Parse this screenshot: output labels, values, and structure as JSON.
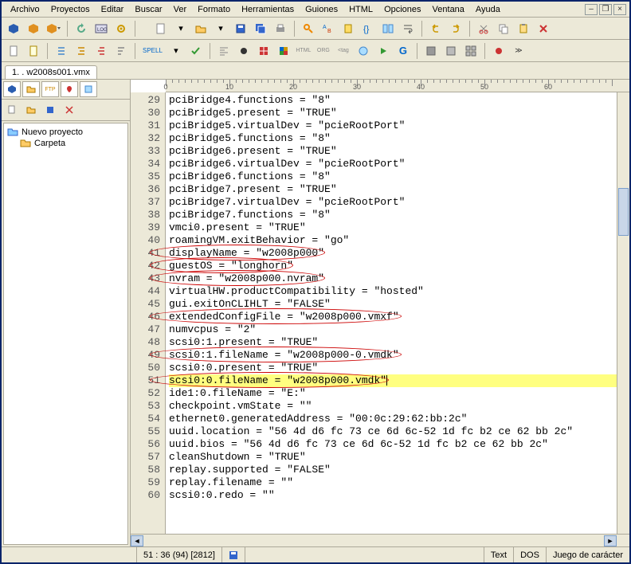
{
  "menu": [
    "Archivo",
    "Proyectos",
    "Editar",
    "Buscar",
    "Ver",
    "Formato",
    "Herramientas",
    "Guiones",
    "HTML",
    "Opciones",
    "Ventana",
    "Ayuda"
  ],
  "tab": "1. . w2008s001.vmx",
  "tree": {
    "root": "Nuevo proyecto",
    "child": "Carpeta"
  },
  "ruler_labels": [
    0,
    10,
    20,
    30,
    40,
    50,
    60
  ],
  "lines": [
    {
      "n": 29,
      "t": "pciBridge4.functions = \"8\""
    },
    {
      "n": 30,
      "t": "pciBridge5.present = \"TRUE\""
    },
    {
      "n": 31,
      "t": "pciBridge5.virtualDev = \"pcieRootPort\""
    },
    {
      "n": 32,
      "t": "pciBridge5.functions = \"8\""
    },
    {
      "n": 33,
      "t": "pciBridge6.present = \"TRUE\""
    },
    {
      "n": 34,
      "t": "pciBridge6.virtualDev = \"pcieRootPort\""
    },
    {
      "n": 35,
      "t": "pciBridge6.functions = \"8\""
    },
    {
      "n": 36,
      "t": "pciBridge7.present = \"TRUE\""
    },
    {
      "n": 37,
      "t": "pciBridge7.virtualDev = \"pcieRootPort\""
    },
    {
      "n": 38,
      "t": "pciBridge7.functions = \"8\""
    },
    {
      "n": 39,
      "t": "vmci0.present = \"TRUE\""
    },
    {
      "n": 40,
      "t": "roamingVM.exitBehavior = \"go\""
    },
    {
      "n": 41,
      "t": "displayName = \"w2008p000\"",
      "circle": true
    },
    {
      "n": 42,
      "t": "guestOS = \"longhorn\"",
      "circle": true
    },
    {
      "n": 43,
      "t": "nvram = \"w2008p000.nvram\"",
      "circle": true
    },
    {
      "n": 44,
      "t": "virtualHW.productCompatibility = \"hosted\""
    },
    {
      "n": 45,
      "t": "gui.exitOnCLIHLT = \"FALSE\""
    },
    {
      "n": 46,
      "t": "extendedConfigFile = \"w2008p000.vmxf\"",
      "circle": true
    },
    {
      "n": 47,
      "t": "numvcpus = \"2\""
    },
    {
      "n": 48,
      "t": "scsi0:1.present = \"TRUE\""
    },
    {
      "n": 49,
      "t": "scsi0:1.fileName = \"w2008p000-0.vmdk\"",
      "circle": true
    },
    {
      "n": 50,
      "t": "scsi0:0.present = \"TRUE\""
    },
    {
      "n": 51,
      "t": "scsi0:0.fileName = \"w2008p000.vmdk\"",
      "hl": true,
      "circle": true,
      "cursor": true
    },
    {
      "n": 52,
      "t": "ide1:0.fileName = \"E:\""
    },
    {
      "n": 53,
      "t": "checkpoint.vmState = \"\""
    },
    {
      "n": 54,
      "t": "ethernet0.generatedAddress = \"00:0c:29:62:bb:2c\""
    },
    {
      "n": 55,
      "t": "uuid.location = \"56 4d d6 fc 73 ce 6d 6c-52 1d fc b2 ce 62 bb 2c\""
    },
    {
      "n": 56,
      "t": "uuid.bios = \"56 4d d6 fc 73 ce 6d 6c-52 1d fc b2 ce 62 bb 2c\""
    },
    {
      "n": 57,
      "t": "cleanShutdown = \"TRUE\""
    },
    {
      "n": 58,
      "t": "replay.supported = \"FALSE\""
    },
    {
      "n": 59,
      "t": "replay.filename = \"\""
    },
    {
      "n": 60,
      "t": "scsi0:0.redo = \"\""
    }
  ],
  "status": {
    "pos": "51 : 36  (94)  [2812]",
    "mode": "Text",
    "eol": "DOS",
    "enc": "Juego de carácter"
  },
  "toolbar2_spell": "SPELL"
}
